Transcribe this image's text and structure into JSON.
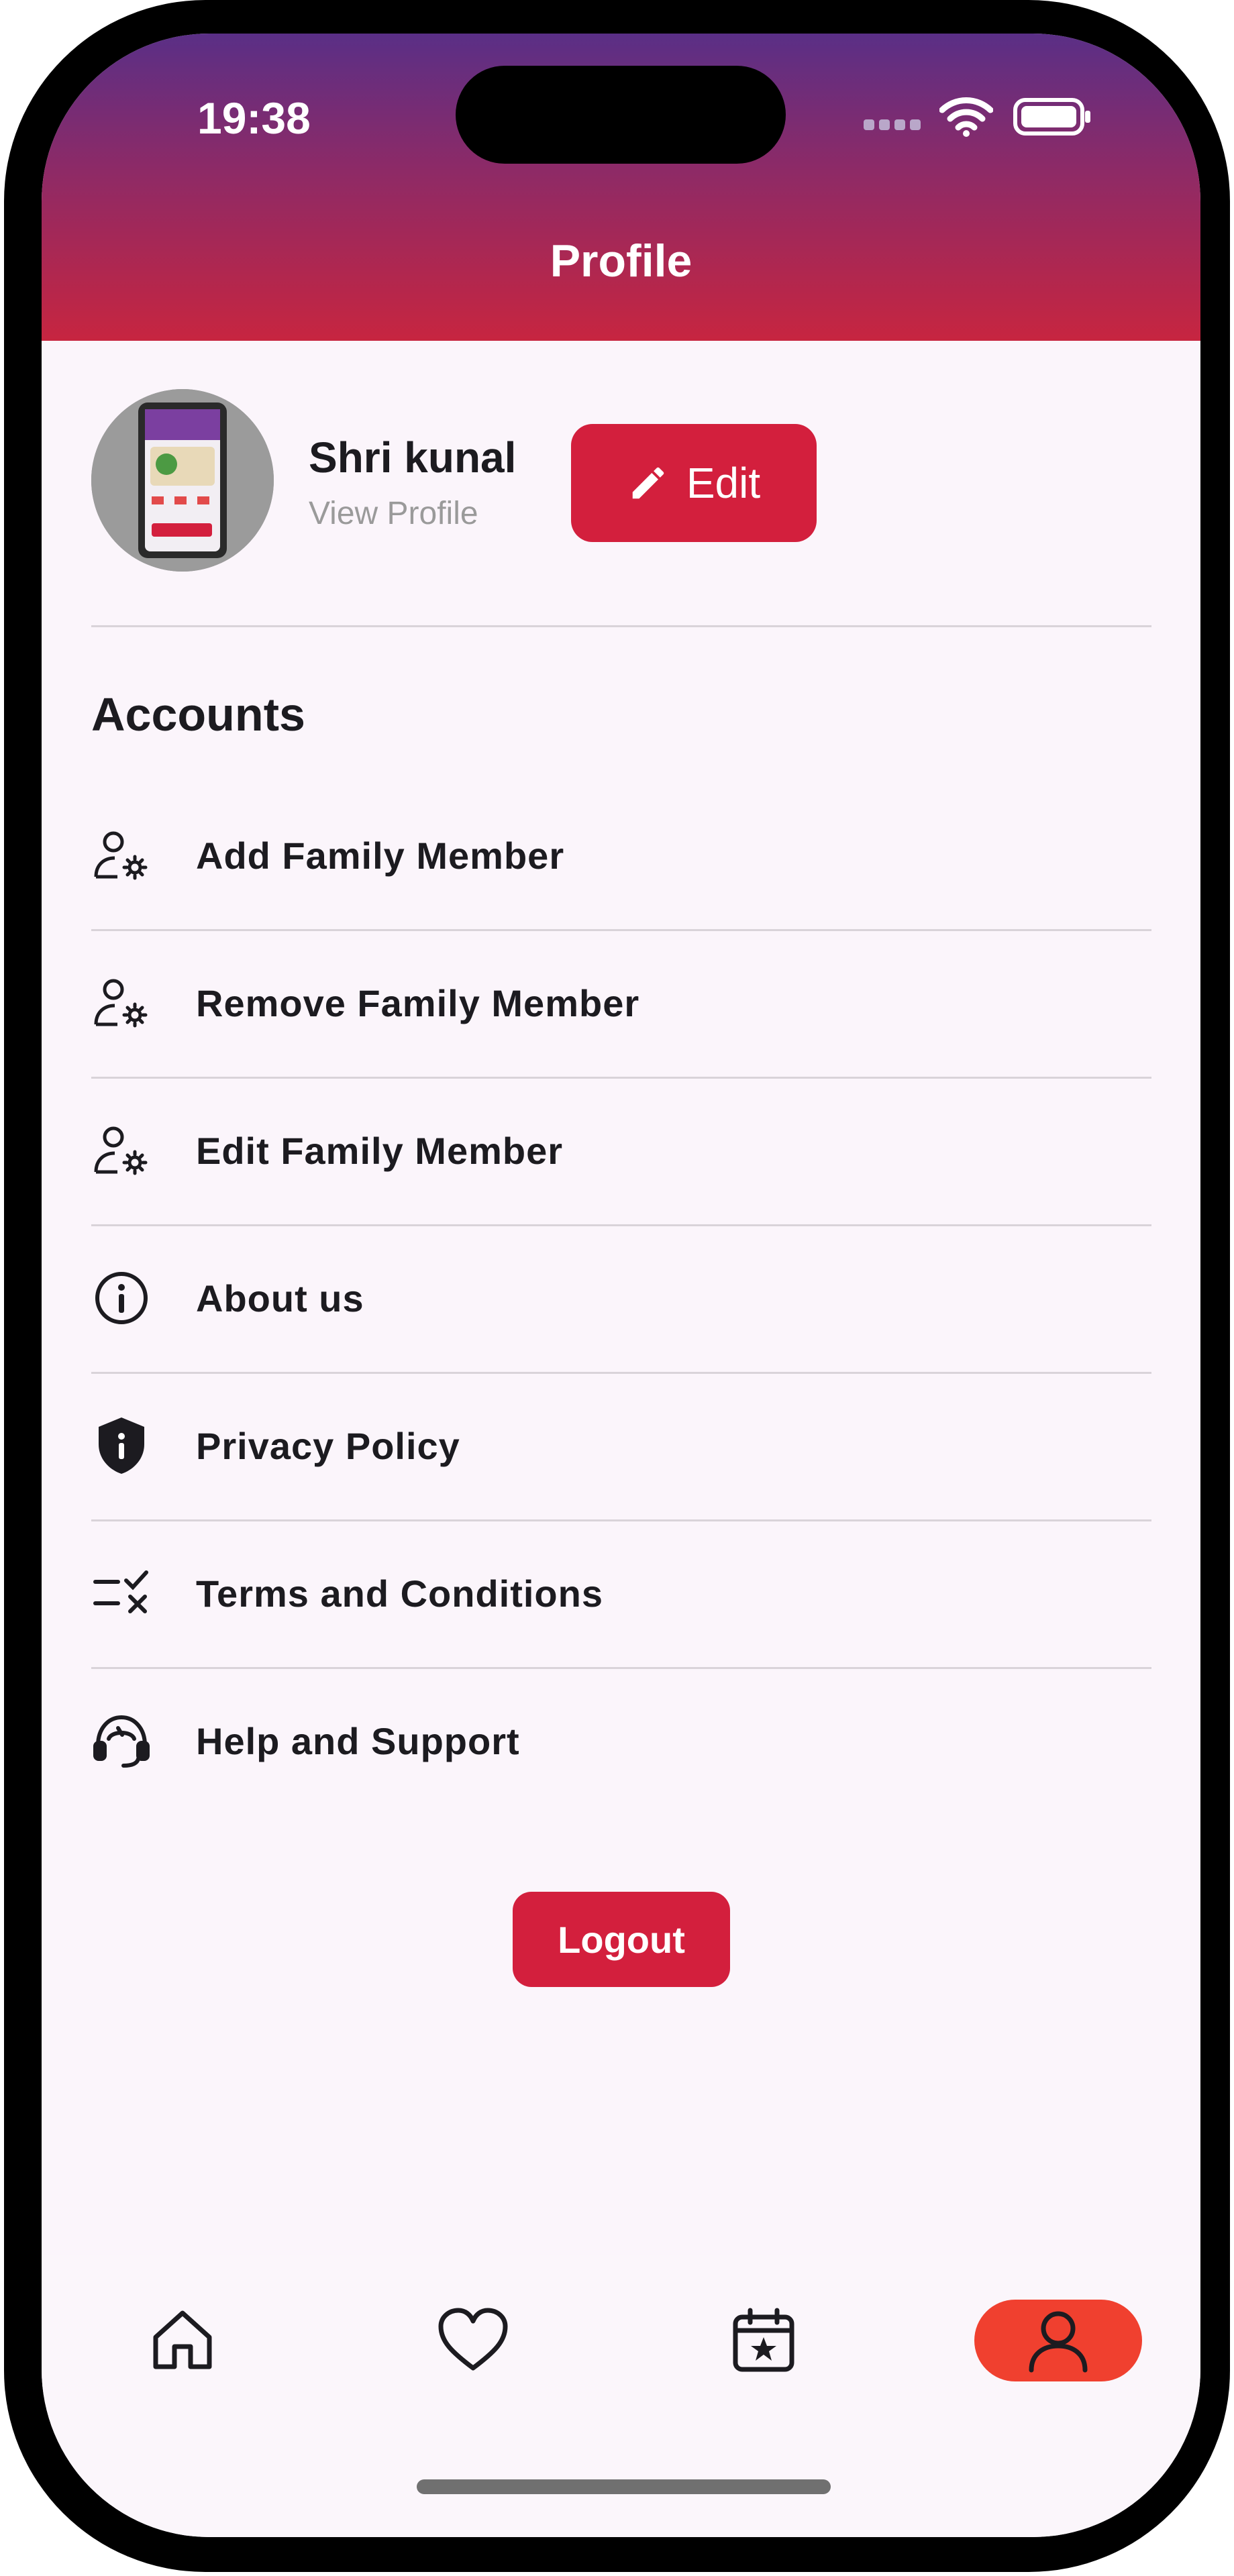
{
  "status_bar": {
    "time": "19:38"
  },
  "header": {
    "title": "Profile"
  },
  "profile": {
    "name": "Shri kunal",
    "view_profile_label": "View Profile",
    "edit_label": "Edit"
  },
  "accounts": {
    "heading": "Accounts",
    "items": [
      {
        "label": "Add Family Member",
        "icon": "user-gear-icon"
      },
      {
        "label": "Remove Family Member",
        "icon": "user-gear-icon"
      },
      {
        "label": "Edit Family Member",
        "icon": "user-gear-icon"
      },
      {
        "label": "About us",
        "icon": "info-icon"
      },
      {
        "label": "Privacy Policy",
        "icon": "shield-info-icon"
      },
      {
        "label": "Terms and Conditions",
        "icon": "checklist-icon"
      },
      {
        "label": "Help and Support",
        "icon": "headset-icon"
      }
    ]
  },
  "logout_label": "Logout",
  "bottom_nav": {
    "items": [
      {
        "name": "home",
        "icon": "home-icon"
      },
      {
        "name": "favorites",
        "icon": "heart-icon"
      },
      {
        "name": "events",
        "icon": "calendar-star-icon"
      },
      {
        "name": "profile",
        "icon": "user-icon",
        "active": true
      }
    ]
  },
  "colors": {
    "primary": "#d31f3d",
    "header_top": "#5a2f86",
    "header_bottom": "#c72540",
    "nav_active": "#f0402f",
    "background": "#fbf5fb"
  }
}
